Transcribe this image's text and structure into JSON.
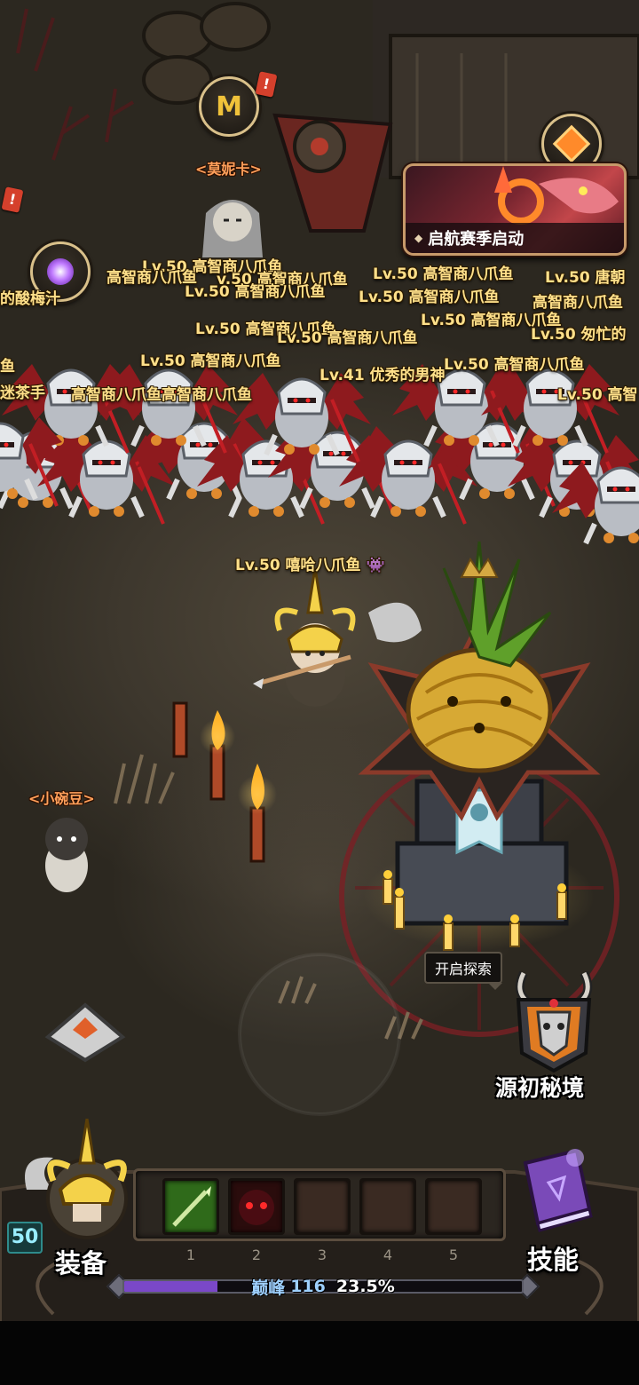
{
  "top_buttons": {
    "monica_npc": "<莫妮卡>",
    "season_banner": "启航赛季启动"
  },
  "player_tags": [
    "Lv.50 高智商八爪鱼",
    "v.50 高智商八爪鱼",
    "Lv.50 高智商八爪鱼",
    "Lv.50 唐朝",
    "Lv.50 高智商八爪鱼",
    "Lv.50 高智商八爪鱼",
    "高智商八爪鱼",
    "高智商八爪鱼",
    "的酸梅汁",
    "Lv.50 高智商八爪鱼",
    "Lv.50 高智商八爪鱼",
    "Lv.50 匆忙的",
    "Lv.50 高智商八爪鱼",
    "Lv.41 优秀的男神",
    "Lv.50 高智商八爪鱼",
    "高智商八爪鱼高智商八爪鱼",
    "Lv.50 高智商八爪鱼",
    "Lv.50 高智",
    "迷茶手",
    "鱼"
  ],
  "local_player": {
    "tag": "Lv.50 嘻哈八爪鱼"
  },
  "npc_pea": "<小碗豆>",
  "explore": {
    "bubble": "开启探索",
    "realm_label": "源初秘境"
  },
  "hud": {
    "level": "50",
    "equip_label": "装备",
    "skill_label": "技能",
    "slot_numbers": [
      "1",
      "2",
      "3",
      "4",
      "5"
    ],
    "peak_label": "巅峰",
    "peak_value": "116",
    "peak_percent": "23.5%",
    "peak_progress": 0.235
  },
  "icons": {
    "monica": "monica-merchant-icon",
    "season": "season-orb-icon",
    "portal": "portal-orb-icon",
    "spear_skill": "spear-skill-icon",
    "demon_skill": "demon-skill-icon",
    "skill_book": "skill-book-icon",
    "joystick": "joystick-icon"
  },
  "colors": {
    "name_tag": "#ffe08a",
    "npc_tag": "#ff9f5a",
    "progress_fill": "#7a48c8",
    "banner_border": "#c79a6a"
  }
}
